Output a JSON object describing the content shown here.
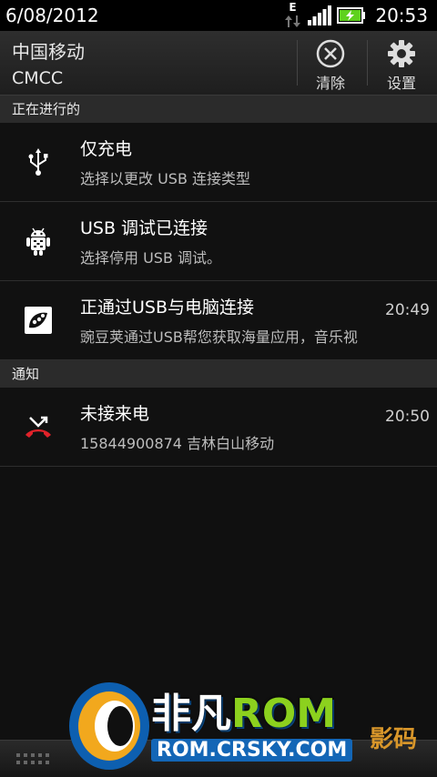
{
  "status_bar": {
    "date": "6/08/2012",
    "network_type": "E",
    "time": "20:53",
    "icons": [
      "data-arrows-icon",
      "signal-icon",
      "battery-charging-icon"
    ]
  },
  "header": {
    "carrier_line1": "中国移动",
    "carrier_line2": "CMCC",
    "clear_label": "清除",
    "settings_label": "设置"
  },
  "sections": {
    "ongoing": "正在进行的",
    "notifications": "通知"
  },
  "ongoing_items": [
    {
      "icon": "usb-icon",
      "title": "仅充电",
      "subtitle": "选择以更改 USB 连接类型",
      "time": ""
    },
    {
      "icon": "android-debug-icon",
      "title": "USB 调试已连接",
      "subtitle": "选择停用 USB 调试。",
      "time": ""
    },
    {
      "icon": "wandoujia-icon",
      "title": "正通过USB与电脑连接",
      "subtitle": "豌豆荚通过USB帮您获取海量应用，音乐视",
      "time": "20:49"
    }
  ],
  "notification_items": [
    {
      "icon": "missed-call-icon",
      "title": "未接来电",
      "subtitle": "15844900874 吉林白山移动",
      "time": "20:50"
    }
  ],
  "watermark": {
    "brand_part1": "非凡",
    "brand_part2": "ROM",
    "url": "ROM.CRSKY.COM",
    "side_text": "影码"
  },
  "colors": {
    "background": "#101010",
    "section_bg": "#2b2b2b",
    "missed_call_red": "#e0222a",
    "battery_green": "#5fd11e"
  }
}
